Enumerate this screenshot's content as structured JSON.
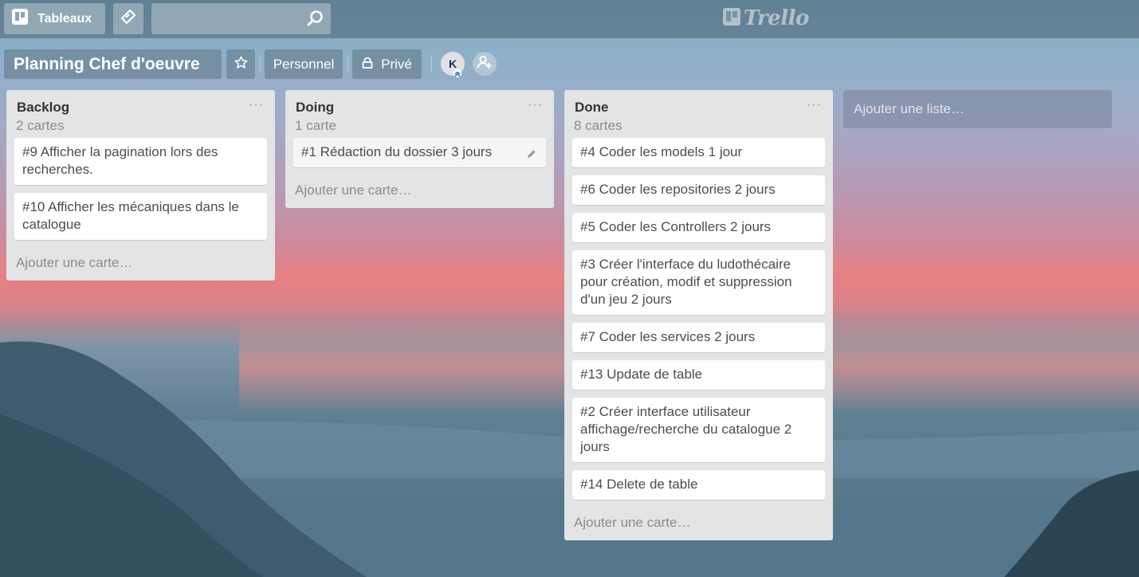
{
  "header": {
    "boards_label": "Tableaux",
    "search_placeholder": "",
    "logo_text": "Trello"
  },
  "board": {
    "title": "Planning Chef d'oeuvre",
    "team_label": "Personnel",
    "visibility_label": "Privé",
    "member_initial": "K"
  },
  "lists": [
    {
      "title": "Backlog",
      "count": "2 cartes",
      "menu": "···",
      "cards": [
        "#9 Afficher la pagination lors des recherches.",
        "#10 Afficher les mécaniques dans le catalogue"
      ],
      "add_label": "Ajouter une carte…"
    },
    {
      "title": "Doing",
      "count": "1 carte",
      "menu": "···",
      "cards": [
        "#1 Rédaction du dossier 3 jours"
      ],
      "add_label": "Ajouter une carte…"
    },
    {
      "title": "Done",
      "count": "8 cartes",
      "menu": "···",
      "cards": [
        "#4 Coder les models 1 jour",
        "#6 Coder les repositories 2 jours",
        "#5 Coder les Controllers 2 jours",
        "#3 Créer l'interface du ludothécaire pour création, modif et suppression d'un jeu 2 jours",
        "#7 Coder les services 2 jours",
        "#13 Update de table",
        "#2 Créer interface utilisateur affichage/recherche du catalogue 2 jours",
        "#14 Delete de table"
      ],
      "add_label": "Ajouter une carte…"
    }
  ],
  "add_list_label": "Ajouter une liste…",
  "icons": {
    "boards": "boards-icon",
    "home": "tag-icon",
    "search": "search-icon",
    "star": "star-icon",
    "lock": "lock-icon",
    "invite": "add-member-icon",
    "edit": "pencil-icon"
  },
  "colors": {
    "list_bg": "#e2e4e6",
    "card_bg": "#ffffff",
    "text": "#4d4d4d"
  }
}
